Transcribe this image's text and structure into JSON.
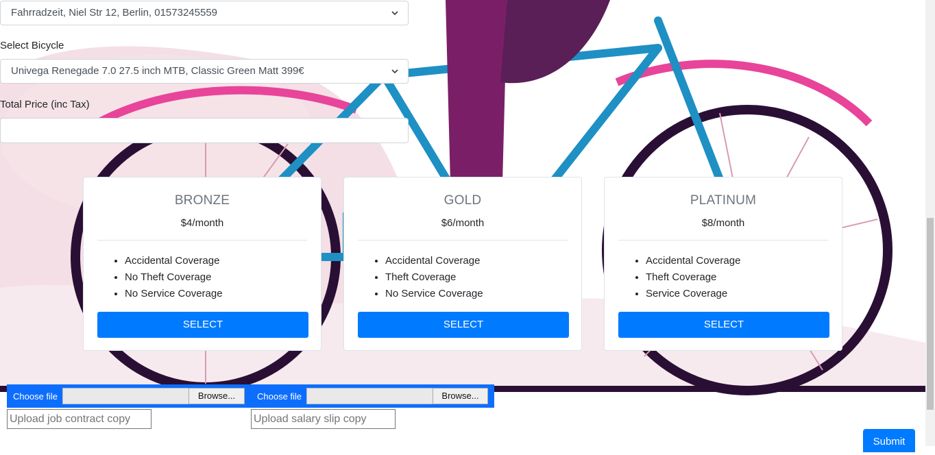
{
  "shop_select": {
    "value": "Fahrradzeit, Niel Str 12, Berlin, 01573245559"
  },
  "bicycle": {
    "label": "Select Bicycle",
    "value": "Univega Renegade 7.0 27.5 inch MTB, Classic Green Matt 399€"
  },
  "total_price": {
    "label": "Total Price (inc Tax)",
    "value": ""
  },
  "plans": [
    {
      "name": "BRONZE",
      "price": "$4/month",
      "features": [
        "Accidental Coverage",
        "No Theft Coverage",
        "No Service Coverage"
      ],
      "button": "SELECT"
    },
    {
      "name": "GOLD",
      "price": "$6/month",
      "features": [
        "Accidental Coverage",
        "Theft Coverage",
        "No Service Coverage"
      ],
      "button": "SELECT"
    },
    {
      "name": "PLATINUM",
      "price": "$8/month",
      "features": [
        "Accidental Coverage",
        "Theft Coverage",
        "Service Coverage"
      ],
      "button": "SELECT"
    }
  ],
  "uploads": [
    {
      "choose_label": "Choose file",
      "browse_label": "Browse...",
      "placeholder": "Upload job contract copy"
    },
    {
      "choose_label": "Choose file",
      "browse_label": "Browse...",
      "placeholder": "Upload salary slip copy"
    }
  ],
  "submit_label": "Submit",
  "colors": {
    "primary": "#007bff",
    "file_bar": "#0d6efd",
    "magenta": "#e8449a",
    "teal": "#1e90c4",
    "purple": "#5a1f57",
    "dark_wheel": "#2a0f35"
  }
}
